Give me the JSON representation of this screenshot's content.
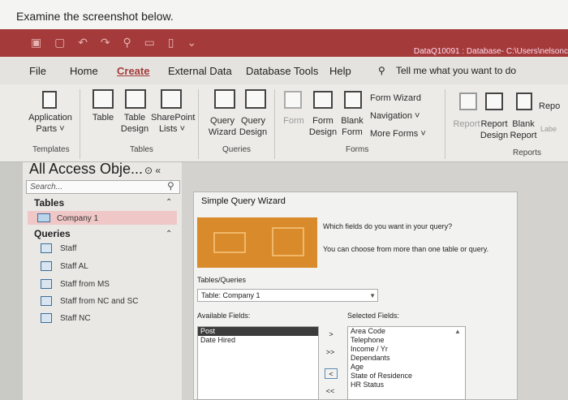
{
  "prompt": "Examine the screenshot below.",
  "window": {
    "title": "DataQ10091 : Database- C:\\Users\\nelsonc"
  },
  "tabs": [
    "File",
    "Home",
    "Create",
    "External Data",
    "Database Tools",
    "Help"
  ],
  "tell_me": "Tell me what you want to do",
  "ribbon": {
    "application_parts": "Application\nParts ˅",
    "table": "Table",
    "table_design": "Table\nDesign",
    "sharepoint": "SharePoint\nLists ˅",
    "query_wizard": "Query\nWizard",
    "query_design": "Query\nDesign",
    "form": "Form",
    "form_design": "Form\nDesign",
    "blank_form": "Blank\nForm",
    "form_wizard": "Form Wizard",
    "navigation": "Navigation ˅",
    "more_forms": "More Forms ˅",
    "report": "Report",
    "report_design": "Report\nDesign",
    "blank_report": "Blank\nReport",
    "report_partial": "Repo",
    "labels_partial": "Labe",
    "groups": {
      "templates": "Templates",
      "tables": "Tables",
      "queries": "Queries",
      "forms": "Forms",
      "reports": "Reports"
    }
  },
  "nav": {
    "title": "All Access Obje...",
    "search": "Search...",
    "tables_header": "Tables",
    "tables": [
      "Company 1"
    ],
    "queries_header": "Queries",
    "queries": [
      "Staff",
      "Staff AL",
      "Staff from MS",
      "Staff from NC and SC",
      "Staff NC"
    ]
  },
  "wizard": {
    "title": "Simple Query Wizard",
    "question": "Which fields do you want in your query?",
    "hint": "You can choose from more than one table or query.",
    "tables_label": "Tables/Queries",
    "table_value": "Table: Company 1",
    "available_label": "Available Fields:",
    "selected_label": "Selected Fields:",
    "available": [
      "Post",
      "Date Hired"
    ],
    "selected": [
      "Area Code",
      "Telephone",
      "Income / Yr",
      "Dependants",
      "Age",
      "State of Residence",
      "HR Status"
    ],
    "btn_add": ">",
    "btn_add_all": ">>",
    "btn_remove": "<",
    "btn_remove_all": "<<"
  }
}
